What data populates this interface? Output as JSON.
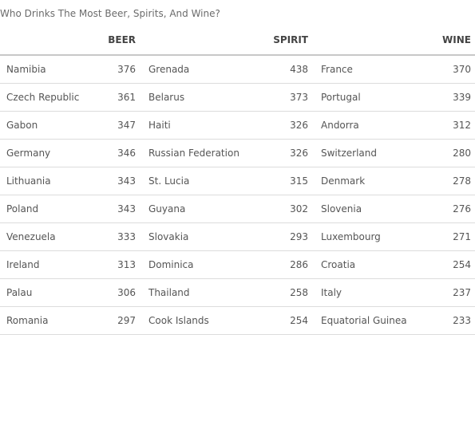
{
  "chart_data": {
    "type": "table",
    "title": "Who Drinks The Most Beer, Spirits, And Wine?",
    "columns": [
      "BEER",
      "SPIRIT",
      "WINE"
    ],
    "rows": [
      {
        "beer": {
          "country": "Namibia",
          "value": 376
        },
        "spirit": {
          "country": "Grenada",
          "value": 438
        },
        "wine": {
          "country": "France",
          "value": 370
        }
      },
      {
        "beer": {
          "country": "Czech Republic",
          "value": 361
        },
        "spirit": {
          "country": "Belarus",
          "value": 373
        },
        "wine": {
          "country": "Portugal",
          "value": 339
        }
      },
      {
        "beer": {
          "country": "Gabon",
          "value": 347
        },
        "spirit": {
          "country": "Haiti",
          "value": 326
        },
        "wine": {
          "country": "Andorra",
          "value": 312
        }
      },
      {
        "beer": {
          "country": "Germany",
          "value": 346
        },
        "spirit": {
          "country": "Russian Federation",
          "value": 326
        },
        "wine": {
          "country": "Switzerland",
          "value": 280
        }
      },
      {
        "beer": {
          "country": "Lithuania",
          "value": 343
        },
        "spirit": {
          "country": "St. Lucia",
          "value": 315
        },
        "wine": {
          "country": "Denmark",
          "value": 278
        }
      },
      {
        "beer": {
          "country": "Poland",
          "value": 343
        },
        "spirit": {
          "country": "Guyana",
          "value": 302
        },
        "wine": {
          "country": "Slovenia",
          "value": 276
        }
      },
      {
        "beer": {
          "country": "Venezuela",
          "value": 333
        },
        "spirit": {
          "country": "Slovakia",
          "value": 293
        },
        "wine": {
          "country": "Luxembourg",
          "value": 271
        }
      },
      {
        "beer": {
          "country": "Ireland",
          "value": 313
        },
        "spirit": {
          "country": "Dominica",
          "value": 286
        },
        "wine": {
          "country": "Croatia",
          "value": 254
        }
      },
      {
        "beer": {
          "country": "Palau",
          "value": 306
        },
        "spirit": {
          "country": "Thailand",
          "value": 258
        },
        "wine": {
          "country": "Italy",
          "value": 237
        }
      },
      {
        "beer": {
          "country": "Romania",
          "value": 297
        },
        "spirit": {
          "country": "Cook Islands",
          "value": 254
        },
        "wine": {
          "country": "Equatorial Guinea",
          "value": 233
        }
      }
    ]
  }
}
